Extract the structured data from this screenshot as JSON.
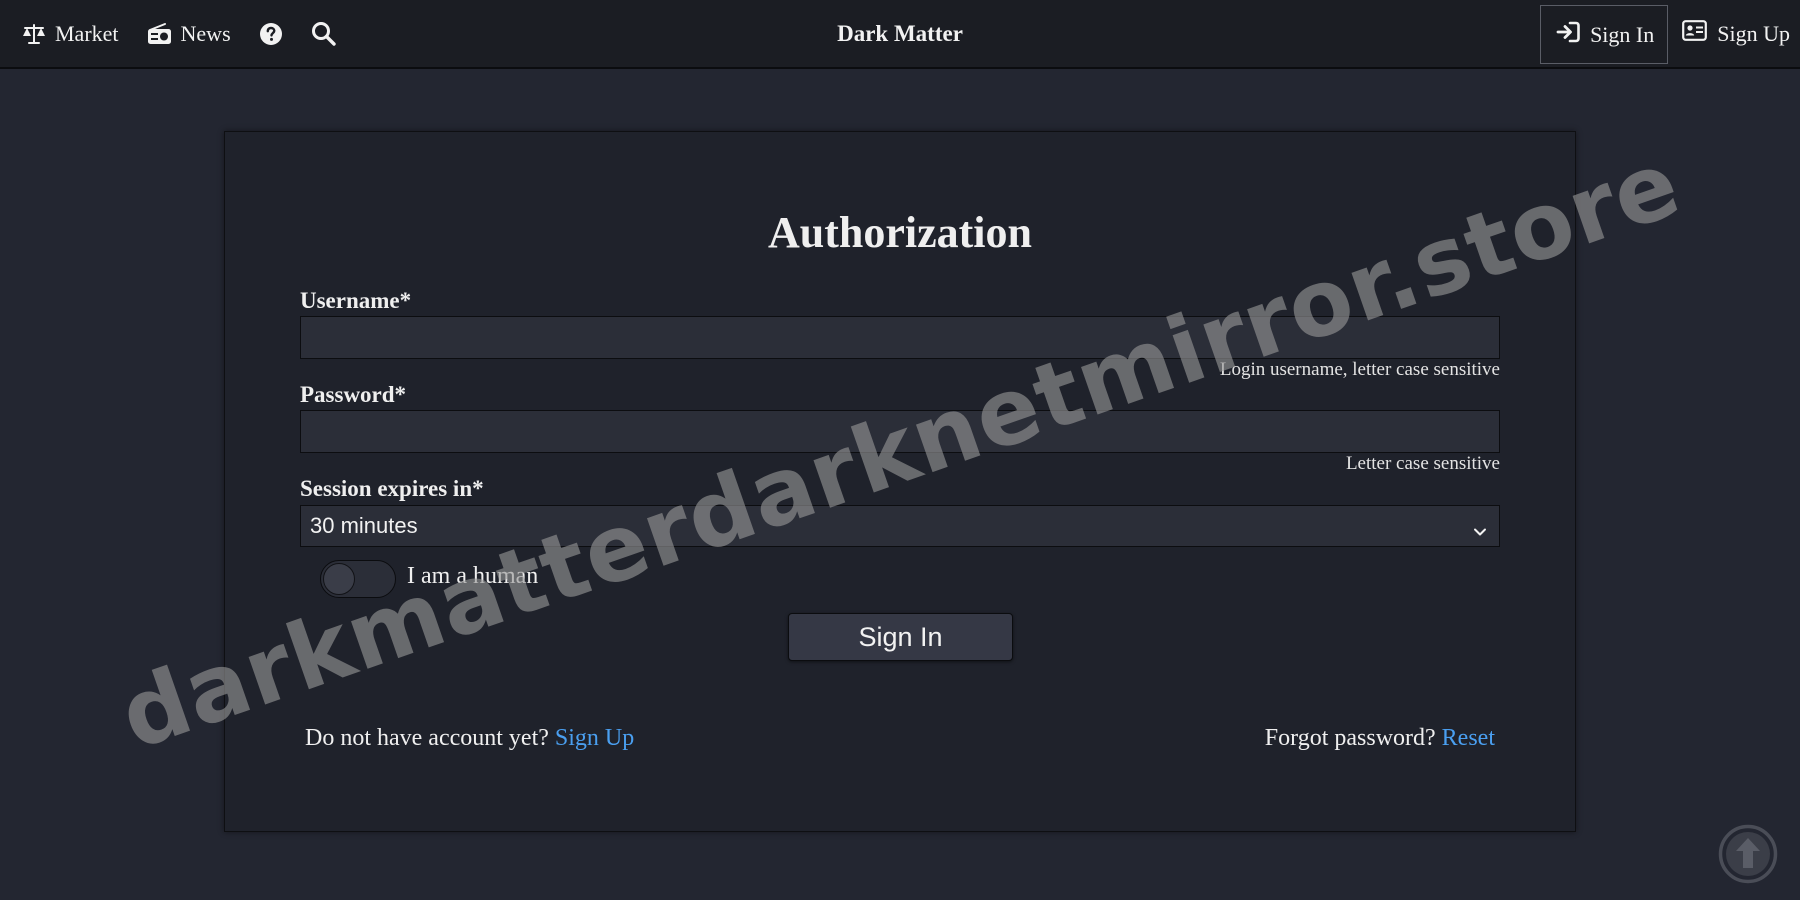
{
  "nav": {
    "market_label": "Market",
    "news_label": "News",
    "brand": "Dark Matter",
    "signin_label": "Sign In",
    "signup_label": "Sign Up"
  },
  "form": {
    "title": "Authorization",
    "username_label": "Username*",
    "username_value": "",
    "username_hint": "Login username, letter case sensitive",
    "password_label": "Password*",
    "password_value": "",
    "password_hint": "Letter case sensitive",
    "session_label": "Session expires in*",
    "session_selected": "30 minutes",
    "human_toggle_on": false,
    "human_label": "I am a human",
    "submit_label": "Sign In"
  },
  "footer": {
    "no_account_text": "Do not have account yet?",
    "signup_link": "Sign Up",
    "forgot_text": "Forgot password?",
    "reset_link": "Reset"
  },
  "watermark": "darkmatterdarknetmirror.store",
  "icons": {
    "market": "balance-scale-icon",
    "news": "radio-icon",
    "help": "question-circle-icon",
    "search": "search-icon",
    "signin": "sign-in-icon",
    "signup": "id-card-icon",
    "select": "chevron-down-icon",
    "scroll_top": "arrow-up-circle-icon"
  },
  "colors": {
    "background": "#232631",
    "navbar": "#1b1d23",
    "card": "#1f222b",
    "input": "#2b2e38",
    "link": "#4a9ff0",
    "text": "#efefef"
  }
}
